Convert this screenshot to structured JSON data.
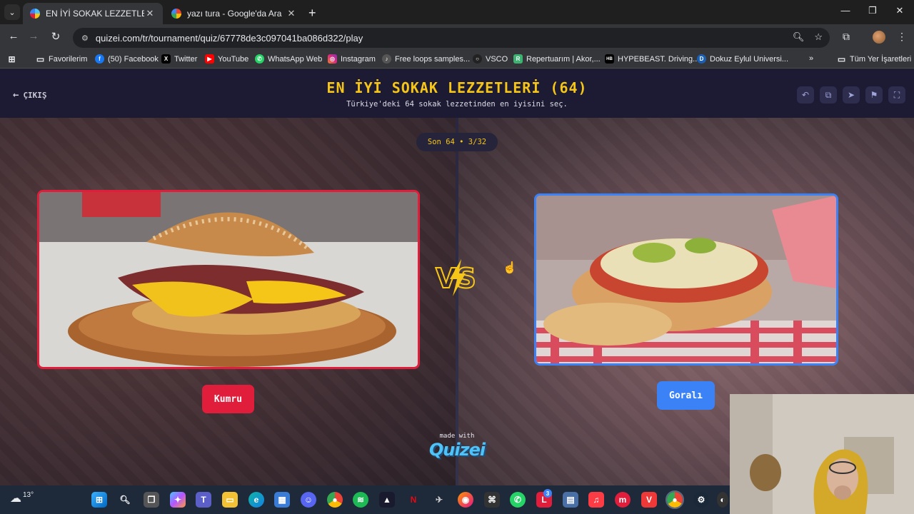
{
  "browser": {
    "tabs": [
      {
        "title": "EN İYİ SOKAK LEZZETLERİ (64)",
        "active": true
      },
      {
        "title": "yazı tura - Google'da Ara",
        "active": false
      }
    ],
    "url": "quizei.com/tr/tournament/quiz/67778de3c097041ba086d322/play",
    "bookmarks": [
      {
        "label": "Favorilerim",
        "icon": "folder-icon"
      },
      {
        "label": "(50) Facebook",
        "icon": "facebook-icon"
      },
      {
        "label": "Twitter",
        "icon": "x-icon"
      },
      {
        "label": "YouTube",
        "icon": "youtube-icon"
      },
      {
        "label": "WhatsApp Web",
        "icon": "whatsapp-icon"
      },
      {
        "label": "Instagram",
        "icon": "instagram-icon"
      },
      {
        "label": "Free loops samples...",
        "icon": "loops-icon"
      },
      {
        "label": "VSCO",
        "icon": "vsco-icon"
      },
      {
        "label": "Repertuarım | Akor,...",
        "icon": "repertuar-icon"
      },
      {
        "label": "HYPEBEAST. Driving...",
        "icon": "hypebeast-icon"
      },
      {
        "label": "Dokuz Eylul Universi...",
        "icon": "deu-icon"
      }
    ],
    "all_bookmarks_label": "Tüm Yer İşaretleri"
  },
  "page": {
    "exit_label": "ÇIKIŞ",
    "title": "EN İYİ SOKAK LEZZETLERİ (64)",
    "subtitle": "Türkiye'deki 64 sokak lezzetinden en iyisini seç.",
    "round": "Son 64 • 3/32",
    "left_choice": "Kumru",
    "right_choice": "Goralı",
    "made_with": "made with",
    "brand": "Quizei",
    "colors": {
      "left": "#e11d3c",
      "right": "#3b82f6",
      "title": "#f5c518"
    }
  },
  "taskbar": {
    "temperature": "13°",
    "icons": [
      "windows-start-icon",
      "search-icon",
      "task-view-icon",
      "copilot-icon",
      "teams-icon",
      "file-explorer-icon",
      "edge-icon",
      "store-icon",
      "discord-icon",
      "chrome-icon",
      "spotify-icon",
      "affinity-icon",
      "netflix-icon",
      "app-icon",
      "firefox-icon",
      "terminal-icon",
      "whatsapp-icon",
      "app-l-icon",
      "app-window-icon",
      "music-icon",
      "app-m-icon",
      "vivaldi-icon",
      "chrome-active-icon",
      "steam-icon",
      "misc-icon"
    ],
    "badge": "3"
  }
}
